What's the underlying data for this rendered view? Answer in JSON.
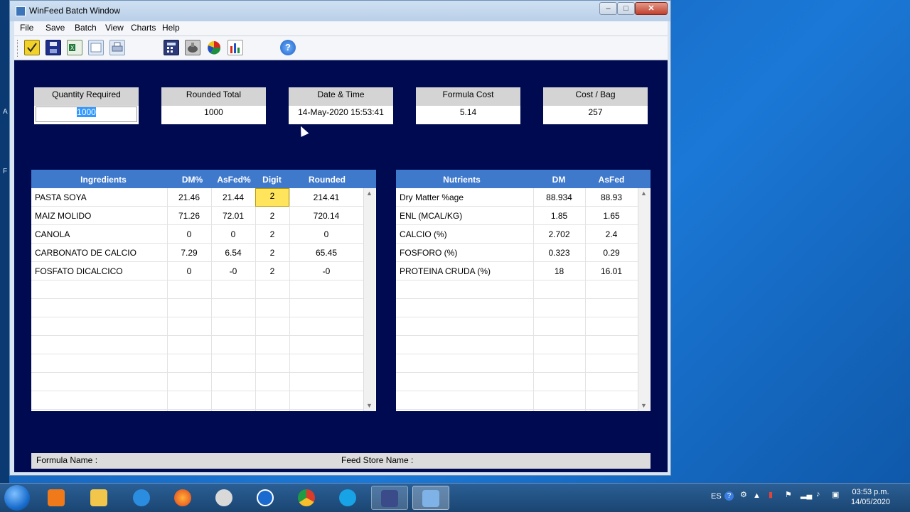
{
  "window": {
    "title": "WinFeed Batch Window",
    "controls": {
      "minimize": "–",
      "maximize": "□",
      "close": "✕"
    }
  },
  "menu": [
    "File",
    "Save",
    "Batch",
    "View",
    "Charts",
    "Help"
  ],
  "toolbar": {
    "icons": [
      "new-formula-icon",
      "save-disk-icon",
      "excel-export-icon",
      "print-preview-icon",
      "printer-icon",
      "calculator-icon",
      "batch-mixer-icon",
      "pie-chart-icon",
      "bar-chart-icon",
      "help-icon"
    ],
    "help_glyph": "?"
  },
  "summary": {
    "quantity_required": {
      "label": "Quantity Required",
      "value": "1000"
    },
    "rounded_total": {
      "label": "Rounded Total",
      "value": "1000"
    },
    "date_time": {
      "label": "Date & Time",
      "value": "14-May-2020 15:53:41"
    },
    "formula_cost": {
      "label": "Formula Cost",
      "value": "5.14"
    },
    "cost_per_bag": {
      "label": "Cost / Bag",
      "value": "257"
    }
  },
  "ingredients": {
    "headers": {
      "name": "Ingredients",
      "dm": "DM%",
      "asfed": "AsFed%",
      "digit": "Digit",
      "rounded": "Rounded"
    },
    "rows": [
      {
        "name": "PASTA SOYA",
        "dm": "21.46",
        "asfed": "21.44",
        "digit": "2",
        "rounded": "214.41"
      },
      {
        "name": "MAIZ MOLIDO",
        "dm": "71.26",
        "asfed": "72.01",
        "digit": "2",
        "rounded": "720.14"
      },
      {
        "name": "CANOLA",
        "dm": "0",
        "asfed": "0",
        "digit": "2",
        "rounded": "0"
      },
      {
        "name": "CARBONATO DE CALCIO",
        "dm": "7.29",
        "asfed": "6.54",
        "digit": "2",
        "rounded": "65.45"
      },
      {
        "name": "FOSFATO DICALCICO",
        "dm": "0",
        "asfed": "-0",
        "digit": "2",
        "rounded": "-0"
      }
    ]
  },
  "nutrients": {
    "headers": {
      "name": "Nutrients",
      "dm": "DM",
      "asfed": "AsFed"
    },
    "rows": [
      {
        "name": "Dry Matter %age",
        "dm": "88.934",
        "asfed": "88.93"
      },
      {
        "name": "ENL (MCAL/KG)",
        "dm": "1.85",
        "asfed": "1.65"
      },
      {
        "name": "CALCIO (%)",
        "dm": "2.702",
        "asfed": "2.4"
      },
      {
        "name": "FOSFORO (%)",
        "dm": "0.323",
        "asfed": "0.29"
      },
      {
        "name": "PROTEINA CRUDA (%)",
        "dm": "18",
        "asfed": "16.01"
      }
    ]
  },
  "status": {
    "formula_name": "Formula Name :",
    "feed_store_name": "Feed Store Name :"
  },
  "desktop_strip": [
    "A",
    "F"
  ],
  "taskbar": {
    "apps": [
      "media-player-icon",
      "file-explorer-icon",
      "internet-explorer-icon",
      "firefox-icon",
      "app-icon",
      "teamviewer-icon",
      "chrome-icon",
      "skype-icon",
      "save-disk-icon",
      "winfeed-icon"
    ],
    "language": "ES",
    "tray_icons": [
      "help-icon",
      "settings-icon",
      "arrow-up-icon",
      "signal-icon",
      "flag-icon",
      "network-icon",
      "volume-icon",
      "action-center-icon"
    ],
    "time": "03:53 p.m.",
    "date": "14/05/2020"
  },
  "colors": {
    "client_bg": "#000a50",
    "grid_header": "#3f79cc",
    "digit_highlight": "#ffe45c",
    "selection": "#3399ff"
  }
}
